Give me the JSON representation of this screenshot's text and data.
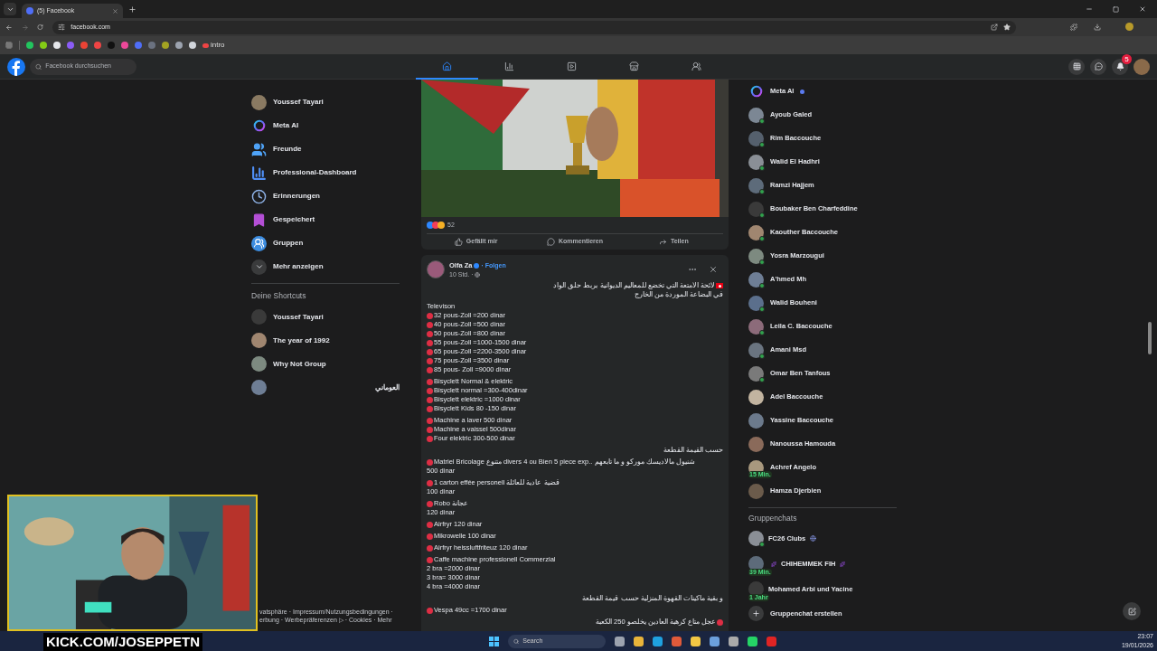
{
  "browser": {
    "tab_title": "(5) Facebook",
    "address": "facebook.com",
    "bookmarks": [
      {
        "kind": "icon",
        "color": "#22c55e"
      },
      {
        "kind": "icon",
        "color": "#84cc16"
      },
      {
        "kind": "icon",
        "color": "#e5e7eb"
      },
      {
        "kind": "icon",
        "color": "#8b5cf6"
      },
      {
        "kind": "icon",
        "color": "#ea4335"
      },
      {
        "kind": "icon",
        "color": "#ef4444"
      },
      {
        "kind": "icon",
        "color": "#111111"
      },
      {
        "kind": "icon",
        "color": "#ec4899"
      },
      {
        "kind": "icon",
        "color": "#4f6ef7"
      },
      {
        "kind": "icon",
        "color": "#6b7280"
      },
      {
        "kind": "icon",
        "color": "#a3a322"
      },
      {
        "kind": "icon",
        "color": "#9ca3af"
      },
      {
        "kind": "icon",
        "color": "#d1d5db"
      },
      {
        "kind": "labelled",
        "color": "#ef4444",
        "label": "intro"
      }
    ]
  },
  "header": {
    "search_placeholder": "Facebook durchsuchen",
    "nav": [
      {
        "kind": "home",
        "selected": true
      },
      {
        "kind": "dashboard",
        "selected": false
      },
      {
        "kind": "video",
        "selected": false
      },
      {
        "kind": "marketplace",
        "selected": false
      },
      {
        "kind": "groups",
        "selected": false
      }
    ],
    "notifications": "5"
  },
  "sidebar": {
    "items": [
      {
        "kind": "avatar",
        "label": "Youssef Tayari"
      },
      {
        "kind": "meta",
        "label": "Meta AI"
      },
      {
        "kind": "friends",
        "label": "Freunde"
      },
      {
        "kind": "dashboard",
        "label": "Professional-Dashboard"
      },
      {
        "kind": "memories",
        "label": "Erinnerungen"
      },
      {
        "kind": "saved",
        "label": "Gespeichert"
      },
      {
        "kind": "groups",
        "label": "Gruppen"
      },
      {
        "kind": "more",
        "label": "Mehr anzeigen"
      }
    ],
    "shortcuts_title": "Deine Shortcuts",
    "shortcuts": [
      {
        "label": "Youssef Tayari"
      },
      {
        "label": "The year of 1992"
      },
      {
        "label": "Why Not Group"
      },
      {
        "label": "العوماني",
        "rtl": true
      }
    ],
    "footer": [
      "vatsphäre · Impressum/Nutzungsbedingungen ·",
      "erbung · Werbepräferenzen ▷ · Cookies · Mehr"
    ]
  },
  "previous_post": {
    "reactions": "52",
    "actions": [
      {
        "kind": "like",
        "label": "Gefällt mir"
      },
      {
        "kind": "comment",
        "label": "Kommentieren"
      },
      {
        "kind": "share",
        "label": "Teilen"
      }
    ]
  },
  "post": {
    "author": "Olfa Za",
    "follow": "· Folgen",
    "time": "10 Std. ·",
    "paragraphs": [
      {
        "rtl": true,
        "lines": [
          {
            "flag": true,
            "text": "لائحة الامتعة التي تخضع للمعاليم الديوانية بربط حلق الواد"
          },
          {
            "text": "في البضاعة الموردة من الخارج"
          }
        ]
      },
      {
        "lines": [
          {
            "text": "Televison"
          },
          {
            "bullet": true,
            "text": "32 pous-Zoll =200 dinar"
          },
          {
            "bullet": true,
            "text": "40 pous-Zoll =500 dinar"
          },
          {
            "bullet": true,
            "text": "50 pous-Zoll =800 dinar"
          },
          {
            "bullet": true,
            "text": "55 pous-Zoll =1000-1500 dinar"
          },
          {
            "bullet": true,
            "text": "65 pous-Zoll =2200-3500 dinar"
          },
          {
            "bullet": true,
            "text": "75 pous-Zoll =3500 dinar"
          },
          {
            "bullet": true,
            "text": "85 pous- Zoll =9000 dinar"
          }
        ]
      },
      {
        "lines": [
          {
            "bullet": true,
            "text": "Bisyclett Normal & elektric"
          },
          {
            "bullet": true,
            "text": "Bisyclett normal =300-400dinar"
          },
          {
            "bullet": true,
            "text": "Bisyclett elektric =1000 dinar"
          },
          {
            "bullet": true,
            "text": "Bisyclett Kids 80 -150 dinar"
          }
        ]
      },
      {
        "lines": [
          {
            "bullet": true,
            "text": "Machine a laver 500 dinar"
          },
          {
            "bullet": true,
            "text": "Machine a vaissel 500dinar"
          },
          {
            "bullet": true,
            "text": "Four elektric 300-500 dinar"
          }
        ]
      },
      {
        "rtl": true,
        "lines": [
          {
            "text": "حسب القيمة القطعة"
          }
        ]
      },
      {
        "lines": [
          {
            "bullet": true,
            "text": "Matriel Bricolage متنوع divers  4 ou Bien 5 piece exp.. شنيول مالاديسك موركو و ما تابعهم"
          },
          {
            "text": "500 dinar"
          }
        ]
      },
      {
        "lines": [
          {
            "bullet": true,
            "text": "1 carton effée personell قضية عادية للعائلة"
          },
          {
            "text": "100 dinar"
          }
        ]
      },
      {
        "lines": [
          {
            "bullet": true,
            "text": "Robo عجانة"
          },
          {
            "text": "120 dinar"
          }
        ]
      },
      {
        "lines": [
          {
            "bullet": true,
            "text": "Airfryr 120 dinar"
          }
        ]
      },
      {
        "lines": [
          {
            "bullet": true,
            "text": "Mikrowelle 100 dinar"
          }
        ]
      },
      {
        "lines": [
          {
            "bullet": true,
            "text": "Airfryr heissluftfriteuz 120 dinar"
          }
        ]
      },
      {
        "lines": [
          {
            "bullet": true,
            "text": "Caffe machine professionell Commerzial"
          },
          {
            "text": "2 bra =2000 dinar"
          },
          {
            "text": "3 bra= 3000 dinar"
          },
          {
            "text": "4 bra =4000 dinar"
          }
        ]
      },
      {
        "rtl": true,
        "lines": [
          {
            "text": "و بقية ماكينات القهوة المنزلية حسب قيمة القطعة"
          }
        ]
      },
      {
        "lines": [
          {
            "bullet": true,
            "text": "Vespa 49cc =1700 dinar"
          }
        ]
      },
      {
        "rtl": true,
        "lines": [
          {
            "bullet": true,
            "text": "عجل متاع كرهبة العادين يخلصو 250 الكعبة"
          }
        ]
      }
    ]
  },
  "contacts": [
    {
      "kind": "meta",
      "name": "Meta AI",
      "verified": true
    },
    {
      "kind": "person",
      "name": "Ayoub Galed",
      "online": true
    },
    {
      "kind": "person",
      "name": "Rim Baccouche",
      "online": true
    },
    {
      "kind": "person",
      "name": "Walid El Hadhri",
      "online": true
    },
    {
      "kind": "person",
      "name": "Ramzi Hajjem",
      "online": true
    },
    {
      "kind": "person",
      "name": "Boubaker Ben Charfeddine",
      "online": true
    },
    {
      "kind": "person",
      "name": "Kaouther Baccouche",
      "online": true
    },
    {
      "kind": "person",
      "name": "Yosra Marzougui",
      "online": true
    },
    {
      "kind": "person",
      "name": "A'hmed Mh",
      "online": true
    },
    {
      "kind": "person",
      "name": "Walid Bouheni",
      "online": true
    },
    {
      "kind": "person",
      "name": "Leila C. Baccouche",
      "online": true
    },
    {
      "kind": "person",
      "name": "Amani Msd",
      "online": true
    },
    {
      "kind": "person",
      "name": "Omar Ben Tanfous",
      "online": true
    },
    {
      "kind": "person",
      "name": "Adel Baccouche"
    },
    {
      "kind": "person",
      "name": "Yassine Baccouche"
    },
    {
      "kind": "person",
      "name": "Nanoussa Hamouda"
    },
    {
      "kind": "person",
      "name": "Achref Angelo",
      "badge": "15 Min."
    },
    {
      "kind": "person",
      "name": "Hamza Djerbien"
    }
  ],
  "group_chats": {
    "title": "Gruppenchats",
    "items": [
      {
        "name": "FC26 Clubs",
        "online": true,
        "globe": true
      },
      {
        "name": "CHIHEMMEK FIH",
        "badge": "39 Min.",
        "sparkles": true
      },
      {
        "name": "Mohamed Arbi und Yacine",
        "badge": "1 Jahr"
      }
    ],
    "create": "Gruppenchat erstellen"
  },
  "stream_overlay": {
    "kind": "picture",
    "caption": "KICK.COM/JOSEPPETN"
  },
  "taskbar": {
    "search_placeholder": "Search",
    "time": "23:07",
    "date": "19/01/2026"
  }
}
